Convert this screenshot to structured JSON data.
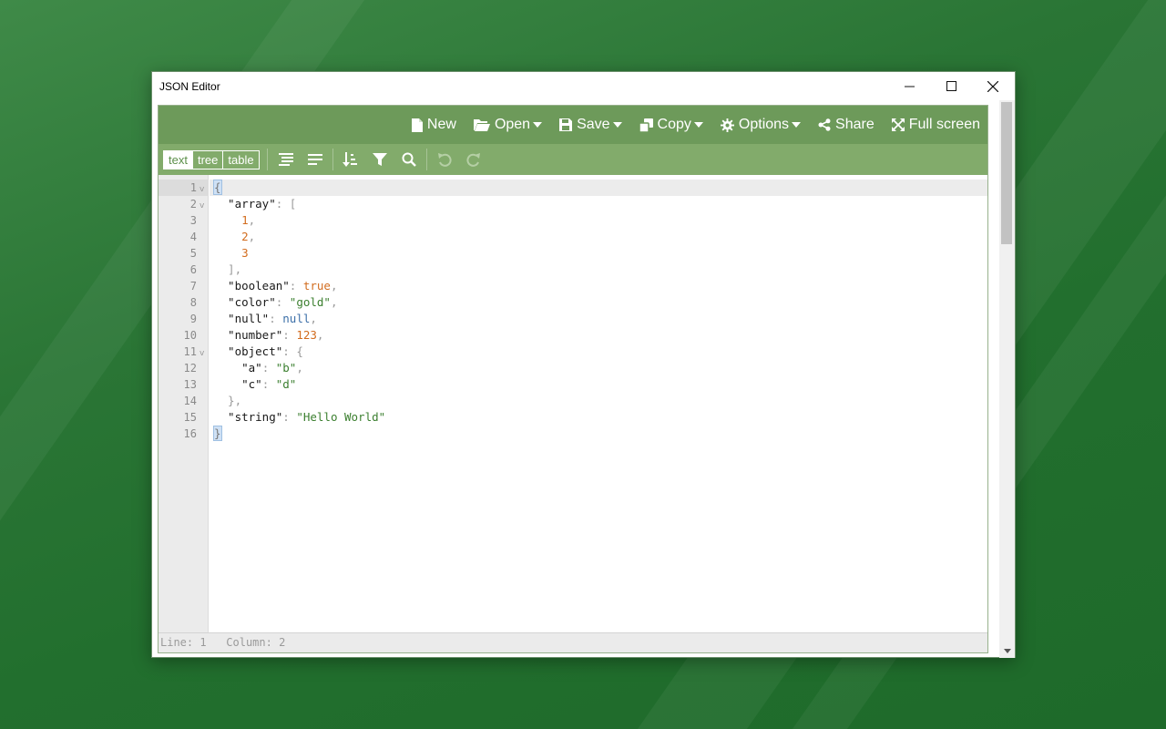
{
  "window": {
    "title": "JSON Editor"
  },
  "menu": {
    "new": "New",
    "open": "Open",
    "save": "Save",
    "copy": "Copy",
    "options": "Options",
    "share": "Share",
    "fullscreen": "Full screen"
  },
  "toolbar": {
    "modes": [
      "text",
      "tree",
      "table"
    ],
    "active_mode": "text"
  },
  "editor": {
    "line_numbers": [
      "1",
      "2",
      "3",
      "4",
      "5",
      "6",
      "7",
      "8",
      "9",
      "10",
      "11",
      "12",
      "13",
      "14",
      "15",
      "16"
    ],
    "foldable_lines": [
      1,
      2,
      11
    ],
    "lines": [
      [
        [
          "brace-hl",
          "{"
        ]
      ],
      [
        [
          "k",
          "  \"array\""
        ],
        [
          "p",
          ": ["
        ]
      ],
      [
        [
          "n",
          "    1"
        ],
        [
          "p",
          ","
        ]
      ],
      [
        [
          "n",
          "    2"
        ],
        [
          "p",
          ","
        ]
      ],
      [
        [
          "n",
          "    3"
        ]
      ],
      [
        [
          "p",
          "  ],"
        ]
      ],
      [
        [
          "k",
          "  \"boolean\""
        ],
        [
          "p",
          ": "
        ],
        [
          "b",
          "true"
        ],
        [
          "p",
          ","
        ]
      ],
      [
        [
          "k",
          "  \"color\""
        ],
        [
          "p",
          ": "
        ],
        [
          "s",
          "\"gold\""
        ],
        [
          "p",
          ","
        ]
      ],
      [
        [
          "k",
          "  \"null\""
        ],
        [
          "p",
          ": "
        ],
        [
          "nl",
          "null"
        ],
        [
          "p",
          ","
        ]
      ],
      [
        [
          "k",
          "  \"number\""
        ],
        [
          "p",
          ": "
        ],
        [
          "n",
          "123"
        ],
        [
          "p",
          ","
        ]
      ],
      [
        [
          "k",
          "  \"object\""
        ],
        [
          "p",
          ": {"
        ]
      ],
      [
        [
          "k",
          "    \"a\""
        ],
        [
          "p",
          ": "
        ],
        [
          "s",
          "\"b\""
        ],
        [
          "p",
          ","
        ]
      ],
      [
        [
          "k",
          "    \"c\""
        ],
        [
          "p",
          ": "
        ],
        [
          "s",
          "\"d\""
        ]
      ],
      [
        [
          "p",
          "  },"
        ]
      ],
      [
        [
          "k",
          "  \"string\""
        ],
        [
          "p",
          ": "
        ],
        [
          "s",
          "\"Hello World\""
        ]
      ],
      [
        [
          "brace-hl",
          "}"
        ]
      ]
    ]
  },
  "status": {
    "line_label": "Line:",
    "line_value": "1",
    "column_label": "Column:",
    "column_value": "2"
  },
  "colors": {
    "menu_bg": "#6d9a5a",
    "toolbar_bg": "#82ab6b",
    "string": "#3b7f2f",
    "number": "#d26c1e",
    "null": "#3c6fa8"
  }
}
